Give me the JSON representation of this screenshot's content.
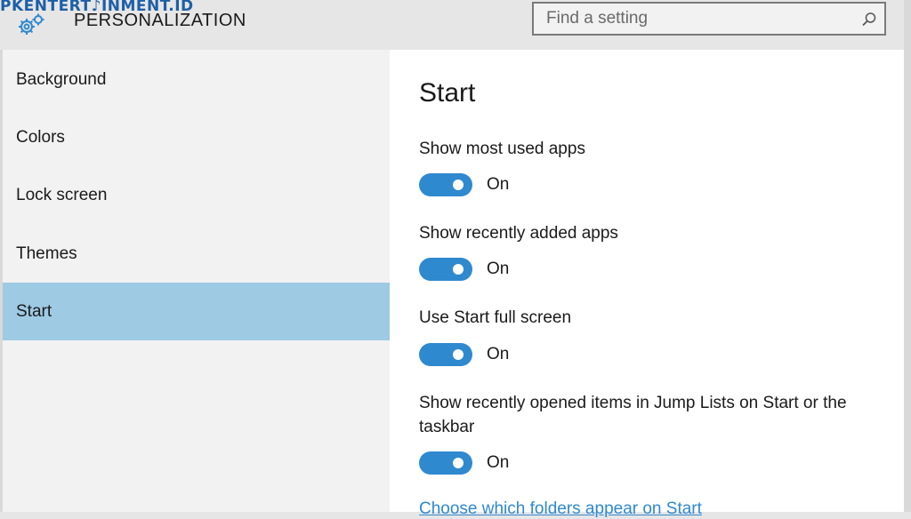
{
  "watermark": "PKENTERT♪INMENT.ID",
  "header": {
    "title": "PERSONALIZATION",
    "icon": "gear-icon",
    "search": {
      "placeholder": "Find a setting",
      "value": "",
      "icon": "search-icon"
    }
  },
  "sidebar": {
    "items": [
      {
        "label": "Background",
        "active": false
      },
      {
        "label": "Colors",
        "active": false
      },
      {
        "label": "Lock screen",
        "active": false
      },
      {
        "label": "Themes",
        "active": false
      },
      {
        "label": "Start",
        "active": true
      }
    ]
  },
  "main": {
    "title": "Start",
    "settings": [
      {
        "label": "Show most used apps",
        "state": "On",
        "on": true
      },
      {
        "label": "Show recently added apps",
        "state": "On",
        "on": true
      },
      {
        "label": "Use Start full screen",
        "state": "On",
        "on": true
      },
      {
        "label": "Show recently opened items in Jump Lists on Start or the taskbar",
        "state": "On",
        "on": true
      }
    ],
    "link": "Choose which folders appear on Start"
  },
  "colors": {
    "accent": "#2f89cf",
    "selected_nav": "#9ecae4",
    "watermark": "#1d5fa8"
  }
}
